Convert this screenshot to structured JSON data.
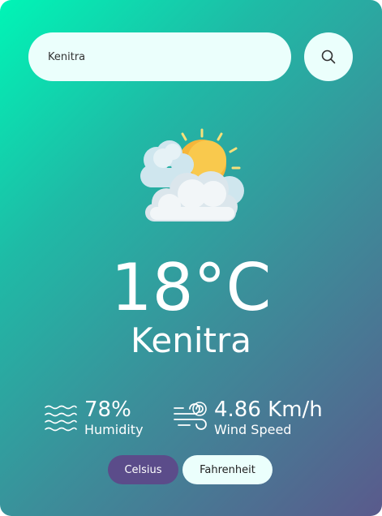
{
  "search": {
    "value": "Kenitra",
    "icon": "search-icon"
  },
  "weather": {
    "icon": "partly-cloudy-sun-icon",
    "temperature": "18°C",
    "city": "Kenitra"
  },
  "stats": {
    "humidity": {
      "icon": "water-waves-icon",
      "value": "78%",
      "label": "Humidity"
    },
    "wind": {
      "icon": "wind-icon",
      "value": "4.86 Km/h",
      "label": "Wind Speed"
    }
  },
  "units": {
    "celsius": "Celsius",
    "fahrenheit": "Fahrenheit",
    "active": "Celsius"
  },
  "colors": {
    "gradient_start": "#00f5b6",
    "gradient_end": "#5a5a8c",
    "active_unit": "#5b4c8a",
    "light_surface": "#ebfffc"
  }
}
